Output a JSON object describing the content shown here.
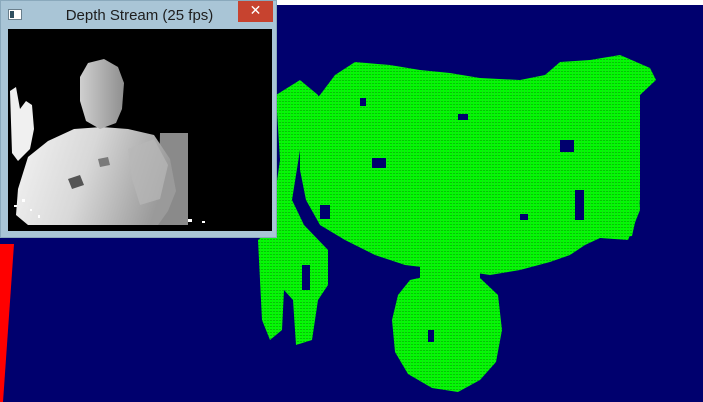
{
  "window": {
    "title": "Depth Stream (25 fps)",
    "close_glyph": "✕",
    "icon": "app-window-icon"
  },
  "depth_view": {
    "description_icon": "depth-image"
  },
  "scene": {
    "background_color": "#00006e",
    "point_cloud_color": "#00ff00",
    "axis_color": "#ff0000",
    "titlebar_color": "#a9c5d6",
    "close_color": "#c7432f"
  }
}
